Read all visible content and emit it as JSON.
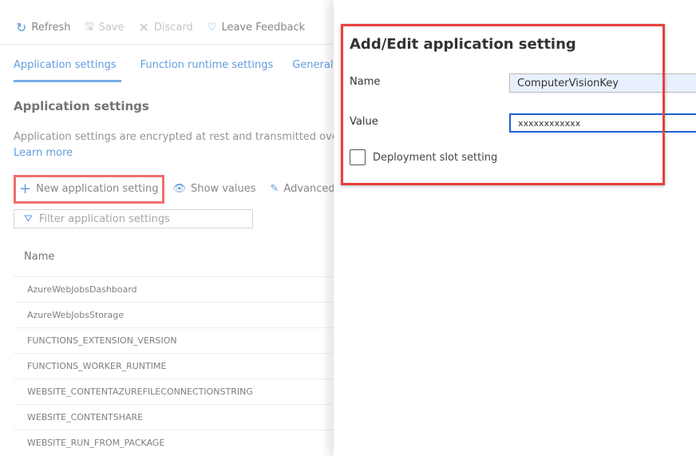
{
  "toolbar": {
    "refresh": "Refresh",
    "save": "Save",
    "discard": "Discard",
    "feedback": "Leave Feedback"
  },
  "tabs": [
    "Application settings",
    "Function runtime settings",
    "General"
  ],
  "section": {
    "title": "Application settings",
    "description": "Application settings are encrypted at rest and transmitted over an",
    "learn_more": "Learn more"
  },
  "actions": {
    "new": "New application setting",
    "show": "Show values",
    "advanced": "Advanced"
  },
  "filter": {
    "placeholder": "Filter application settings"
  },
  "table": {
    "column": "Name",
    "rows": [
      "AzureWebJobsDashboard",
      "AzureWebJobsStorage",
      "FUNCTIONS_EXTENSION_VERSION",
      "FUNCTIONS_WORKER_RUNTIME",
      "WEBSITE_CONTENTAZUREFILECONNECTIONSTRING",
      "WEBSITE_CONTENTSHARE",
      "WEBSITE_RUN_FROM_PACKAGE"
    ]
  },
  "panel": {
    "title": "Add/Edit application setting",
    "name_label": "Name",
    "name_value": "ComputerVisionKey",
    "value_label": "Value",
    "value_value": "xxxxxxxxxxxx",
    "slot_label": "Deployment slot setting",
    "slot_checked": false
  },
  "colors": {
    "accent": "#2b7cd3",
    "highlight": "#e8403f"
  }
}
